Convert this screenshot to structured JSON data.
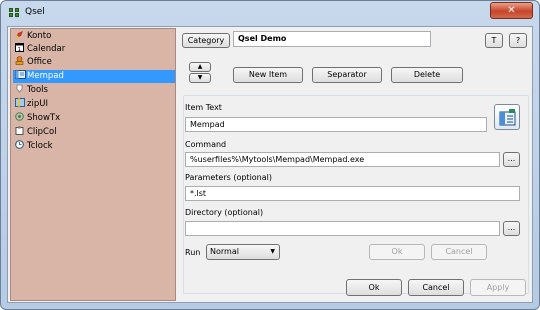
{
  "window": {
    "title": "Qsel",
    "close_label": "✕"
  },
  "sidebar": {
    "items": [
      {
        "label": "Konto",
        "icon": "konto-icon",
        "selected": false
      },
      {
        "label": "Calendar",
        "icon": "calendar-icon",
        "selected": false
      },
      {
        "label": "Office",
        "icon": "office-icon",
        "selected": false
      },
      {
        "label": "Mempad",
        "icon": "mempad-icon",
        "selected": true
      },
      {
        "label": "Tools",
        "icon": "tools-icon",
        "selected": false
      },
      {
        "label": "zipUI",
        "icon": "zipui-icon",
        "selected": false
      },
      {
        "label": "ShowTx",
        "icon": "showtx-icon",
        "selected": false
      },
      {
        "label": "ClipCol",
        "icon": "clipcol-icon",
        "selected": false
      },
      {
        "label": "Tclock",
        "icon": "tclock-icon",
        "selected": false
      }
    ]
  },
  "header": {
    "category_label": "Category",
    "category_value": "Qsel Demo",
    "t_label": "T",
    "help_label": "?"
  },
  "toolbar": {
    "move_up_label": "▲",
    "move_down_label": "▼",
    "new_item_label": "New Item",
    "separator_label": "Separator",
    "delete_label": "Delete"
  },
  "form": {
    "item_text_label": "Item Text",
    "item_text_value": "Mempad",
    "command_label": "Command",
    "command_value": "%userfiles%\\Mytools\\Mempad\\Mempad.exe",
    "browse_label": "...",
    "parameters_label": "Parameters (optional)",
    "parameters_value": "*.lst",
    "directory_label": "Directory (optional)",
    "directory_value": "",
    "run_label": "Run",
    "run_value": "Normal",
    "item_ok_label": "Ok",
    "item_cancel_label": "Cancel"
  },
  "footer": {
    "ok_label": "Ok",
    "cancel_label": "Cancel",
    "apply_label": "Apply"
  }
}
